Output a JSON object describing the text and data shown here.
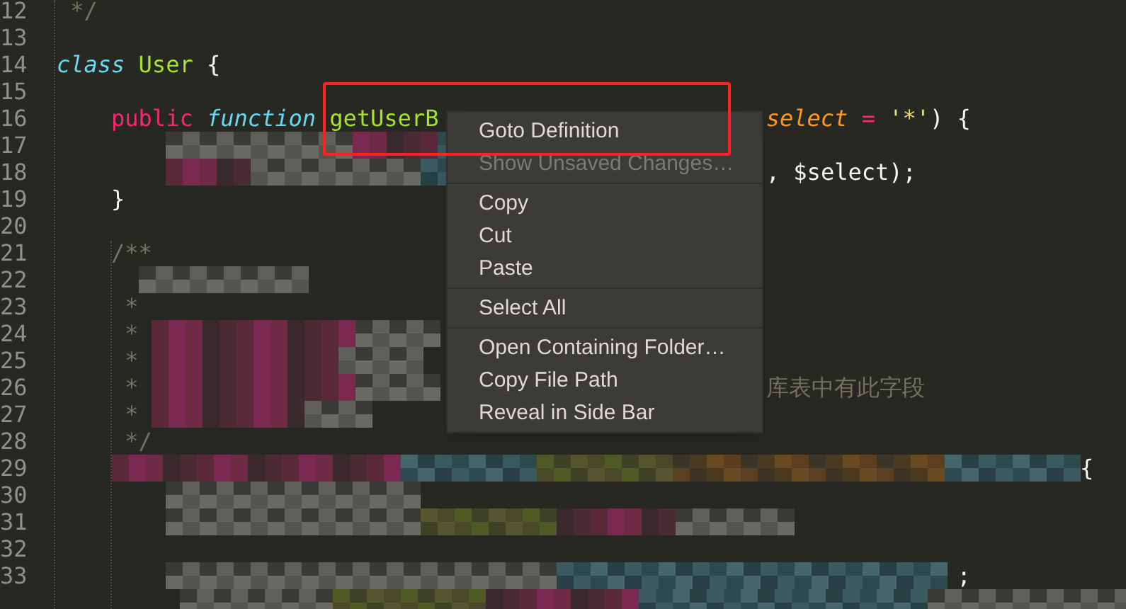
{
  "editor": {
    "lines": [
      {
        "number": "12",
        "tokens": [
          {
            "text": "*/",
            "kind": "comment"
          }
        ]
      },
      {
        "number": "13"
      },
      {
        "number": "14",
        "tokens": [
          {
            "text": "class",
            "kind": "storage"
          },
          {
            "text": "User",
            "kind": "entity"
          },
          {
            "text": "{",
            "kind": "plain"
          }
        ]
      },
      {
        "number": "15"
      },
      {
        "number": "16",
        "tokens": [
          {
            "text": "public",
            "kind": "keyword"
          },
          {
            "text": "function",
            "kind": "storage"
          },
          {
            "text": "getUserB",
            "kind": "entity"
          },
          {
            "text": "select",
            "kind": "parameter"
          },
          {
            "text": "=",
            "kind": "keyword"
          },
          {
            "text": "'*'",
            "kind": "string"
          },
          {
            "text": ")",
            "kind": "plain"
          },
          {
            "text": "{",
            "kind": "plain"
          }
        ]
      },
      {
        "number": "17"
      },
      {
        "number": "18",
        "tokens": [
          {
            "text": ",",
            "kind": "plain"
          },
          {
            "text": "$select);",
            "kind": "plain"
          }
        ]
      },
      {
        "number": "19",
        "tokens": [
          {
            "text": "}",
            "kind": "plain"
          }
        ]
      },
      {
        "number": "20"
      },
      {
        "number": "21",
        "tokens": [
          {
            "text": "/**",
            "kind": "comment"
          }
        ]
      },
      {
        "number": "22"
      },
      {
        "number": "23",
        "tokens": [
          {
            "text": "*",
            "kind": "comment"
          }
        ]
      },
      {
        "number": "24",
        "tokens": [
          {
            "text": "*",
            "kind": "comment"
          }
        ]
      },
      {
        "number": "25",
        "tokens": [
          {
            "text": "*",
            "kind": "comment"
          }
        ]
      },
      {
        "number": "26",
        "tokens": [
          {
            "text": "*",
            "kind": "comment"
          },
          {
            "text": "库表中有此字段",
            "kind": "comment"
          }
        ]
      },
      {
        "number": "27",
        "tokens": [
          {
            "text": "*",
            "kind": "comment"
          }
        ]
      },
      {
        "number": "28",
        "tokens": [
          {
            "text": "*/",
            "kind": "comment"
          }
        ]
      },
      {
        "number": "29",
        "tokens": [
          {
            "text": "{",
            "kind": "plain"
          }
        ]
      },
      {
        "number": "30"
      },
      {
        "number": "31"
      },
      {
        "number": "32"
      },
      {
        "number": "33",
        "tokens": [
          {
            "text": ";",
            "kind": "plain"
          }
        ]
      }
    ]
  },
  "context_menu": {
    "groups": [
      [
        {
          "label": "Goto Definition",
          "disabled": false
        },
        {
          "label": "Show Unsaved Changes…",
          "disabled": true
        }
      ],
      [
        {
          "label": "Copy",
          "disabled": false
        },
        {
          "label": "Cut",
          "disabled": false
        },
        {
          "label": "Paste",
          "disabled": false
        }
      ],
      [
        {
          "label": "Select All",
          "disabled": false
        }
      ],
      [
        {
          "label": "Open Containing Folder…",
          "disabled": false
        },
        {
          "label": "Copy File Path",
          "disabled": false
        },
        {
          "label": "Reveal in Side Bar",
          "disabled": false
        }
      ]
    ]
  }
}
